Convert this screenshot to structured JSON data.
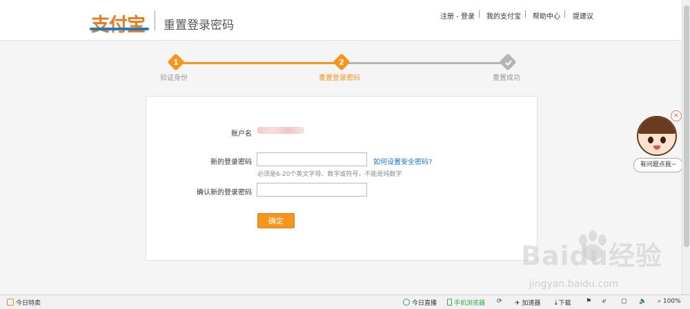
{
  "header": {
    "logo_text": "支付宝",
    "page_title": "重置登录密码",
    "links": [
      "注册 - 登录",
      "我的支付宝",
      "帮助中心",
      "提建议"
    ]
  },
  "steps": [
    {
      "number": "1",
      "label": "验证身份",
      "state": "done"
    },
    {
      "number": "2",
      "label": "重置登录密码",
      "state": "current"
    },
    {
      "number": "",
      "label": "重置成功",
      "state": "pending"
    }
  ],
  "form": {
    "account_label": "账户名",
    "new_password_label": "新的登录密码",
    "new_password_value": "",
    "help_link": "如何设置安全密码?",
    "hint": "必须是6-20个英文字母、数字或符号，不能是纯数字",
    "confirm_label": "确认新的登录密码",
    "confirm_value": "",
    "submit_label": "确定"
  },
  "assistant": {
    "bubble": "有问题点我~",
    "close": "×"
  },
  "watermark": {
    "main": "Baidu经验",
    "sub": "jingyan.baidu.com"
  },
  "statusbar": {
    "left": "今日特卖",
    "items": [
      "今日直播",
      "手机浏览器",
      "加速器",
      "下载"
    ],
    "zoom": "100%"
  },
  "colors": {
    "accent": "#f6941c",
    "link": "#1a73c8",
    "pending": "#b5b5b5"
  }
}
